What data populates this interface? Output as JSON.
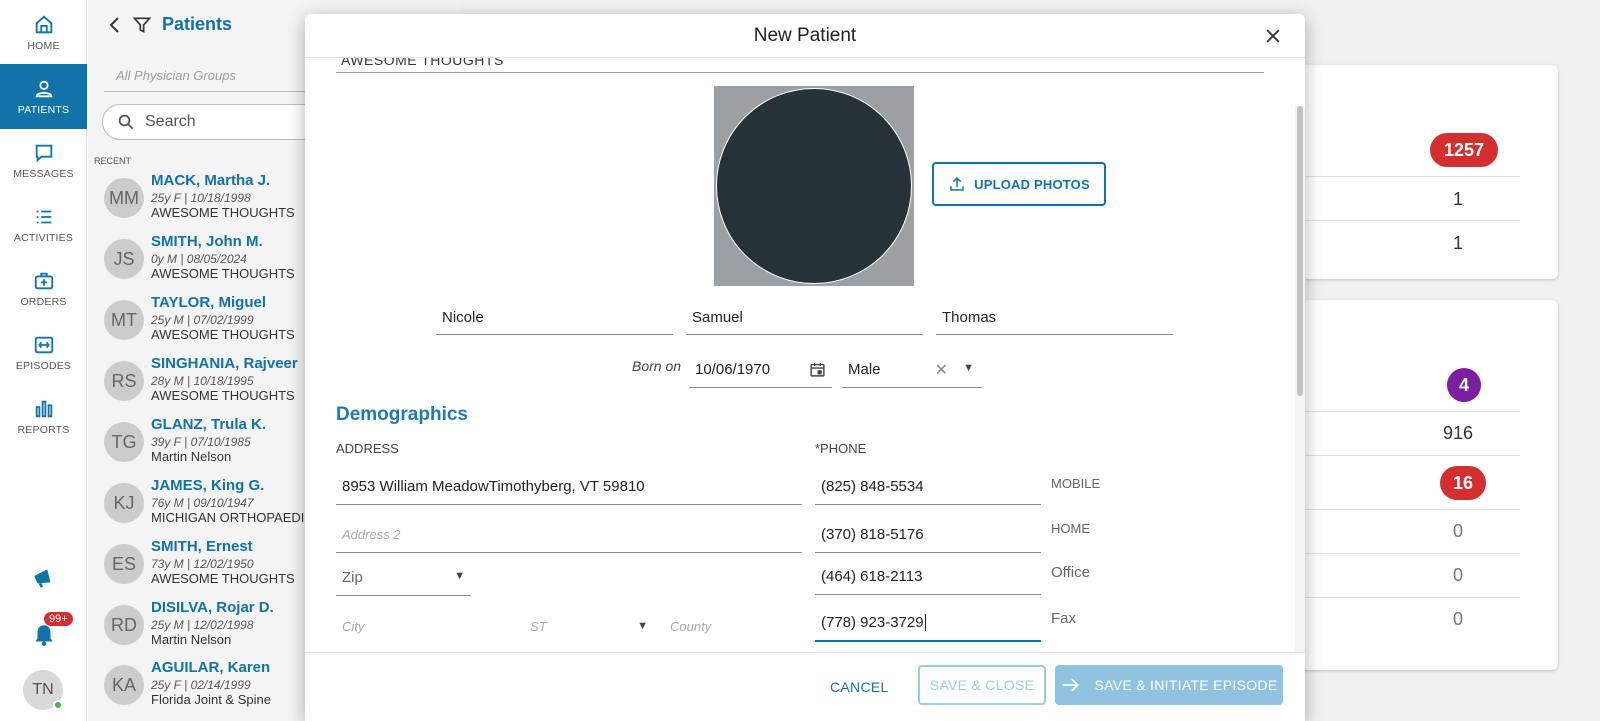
{
  "nav": {
    "items": [
      {
        "label": "HOME",
        "icon": "home-icon"
      },
      {
        "label": "PATIENTS",
        "icon": "person-icon"
      },
      {
        "label": "MESSAGES",
        "icon": "chat-icon"
      },
      {
        "label": "ACTIVITIES",
        "icon": "list-icon"
      },
      {
        "label": "ORDERS",
        "icon": "medical-bag-icon"
      },
      {
        "label": "EPISODES",
        "icon": "episodes-icon"
      },
      {
        "label": "REPORTS",
        "icon": "bar-chart-icon"
      }
    ],
    "notification_badge": "99+",
    "user_initials": "TN"
  },
  "patient_list": {
    "title": "Patients",
    "groups_placeholder": "All Physician Groups",
    "search_placeholder": "Search",
    "recent_label": "RECENT",
    "patients": [
      {
        "initials": "MM",
        "name": "MACK, Martha J.",
        "info": "25y F | 10/18/1998",
        "group": "AWESOME THOUGHTS"
      },
      {
        "initials": "JS",
        "name": "SMITH, John M.",
        "info": "0y M | 08/05/2024",
        "group": "AWESOME THOUGHTS"
      },
      {
        "initials": "MT",
        "name": "TAYLOR, Miguel",
        "info": "25y M | 07/02/1999",
        "group": "AWESOME THOUGHTS"
      },
      {
        "initials": "RS",
        "name": "SINGHANIA, Rajveer",
        "info": "28y M | 10/18/1995",
        "group": "AWESOME THOUGHTS"
      },
      {
        "initials": "TG",
        "name": "GLANZ, Trula K.",
        "info": "39y F | 07/10/1985",
        "group": "Martin Nelson"
      },
      {
        "initials": "KJ",
        "name": "JAMES, King G.",
        "info": "76y M | 09/10/1947",
        "group": "MICHIGAN ORTHOPAEDIC"
      },
      {
        "initials": "ES",
        "name": "SMITH, Ernest",
        "info": "73y M | 12/02/1950",
        "group": "AWESOME THOUGHTS"
      },
      {
        "initials": "RD",
        "name": "DISILVA, Rojar D.",
        "info": "25y M | 12/02/1998",
        "group": "Martin Nelson"
      },
      {
        "initials": "KA",
        "name": "AGUILAR, Karen",
        "info": "25y F | 02/14/1999",
        "group": "Florida Joint & Spine"
      }
    ]
  },
  "background_cards": {
    "card1": {
      "pill": "1257",
      "values": [
        "1",
        "1"
      ]
    },
    "card2": {
      "pill_purple": "4",
      "value1": "916",
      "pill_red": "16",
      "values": [
        "0",
        "0",
        "0"
      ]
    }
  },
  "colors": {
    "accent": "#1273a8",
    "badge_red": "#d32f2f",
    "badge_purple": "#7b1fa2"
  },
  "modal": {
    "title": "New Patient",
    "cut_text": "AWESOME THOUGHTS",
    "upload_label": "UPLOAD PHOTOS",
    "first_name": "Nicole",
    "middle_name": "Samuel",
    "last_name": "Thomas",
    "born_label": "Born on",
    "dob": "10/06/1970",
    "sex": "Male",
    "section_title": "Demographics",
    "address_label": "ADDRESS",
    "address1": "8953 William MeadowTimothyberg, VT 59810",
    "address2_placeholder": "Address 2",
    "zip_placeholder": "Zip",
    "city_placeholder": "City",
    "state_placeholder": "ST",
    "county_placeholder": "County",
    "phone_label": "*PHONE",
    "phones": [
      {
        "number": "(825) 848-5534",
        "type": "MOBILE"
      },
      {
        "number": "(370) 818-5176",
        "type": "HOME"
      },
      {
        "number": "(464) 618-2113",
        "type": "Office"
      },
      {
        "number": "(778) 923-3729",
        "type": "Fax"
      }
    ],
    "cancel_label": "CANCEL",
    "save_close_label": "SAVE & CLOSE",
    "initiate_label": "SAVE & INITIATE EPISODE"
  }
}
